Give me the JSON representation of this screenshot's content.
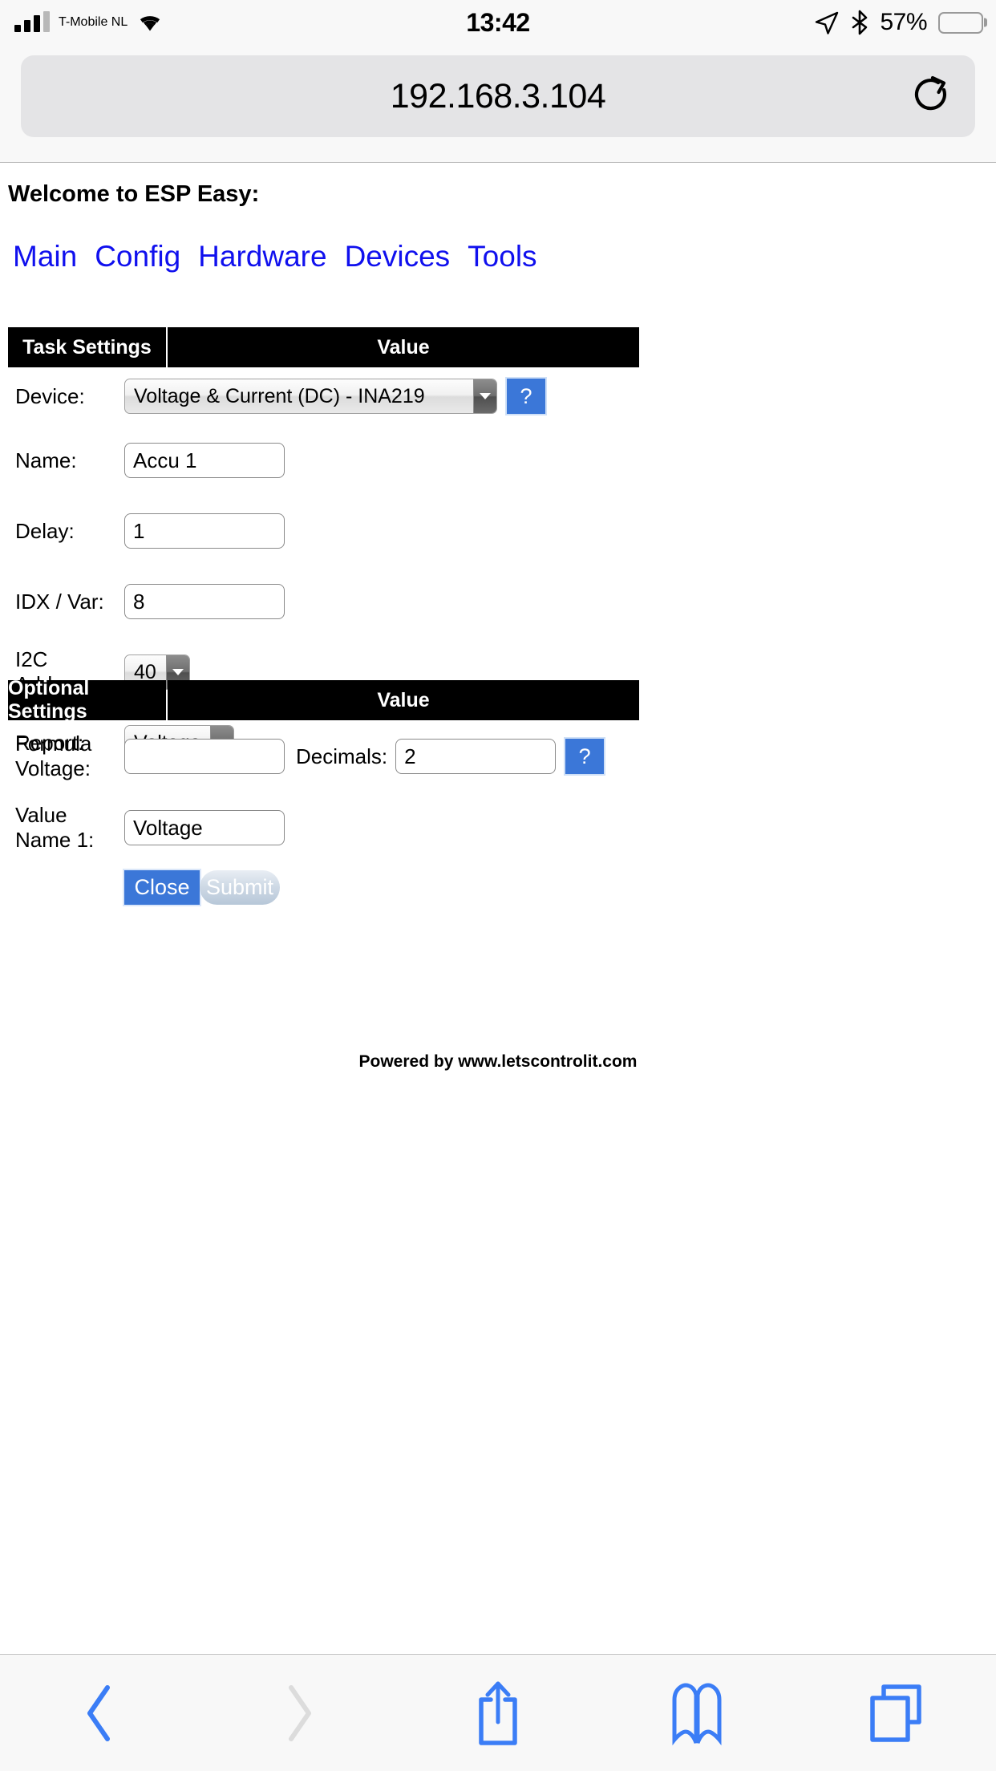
{
  "status_bar": {
    "carrier": "T-Mobile NL",
    "time": "13:42",
    "battery_percent": "57%",
    "signal_icon": "cellular-bars-icon",
    "wifi_icon": "wifi-icon",
    "location_icon": "location-arrow-icon",
    "bluetooth_icon": "bluetooth-icon",
    "battery_icon": "battery-icon",
    "battery_level": 57
  },
  "browser": {
    "url": "192.168.3.104",
    "reload_icon": "reload-icon",
    "toolbar": {
      "back_label": "Back",
      "forward_label": "Forward",
      "share_label": "Share",
      "bookmarks_label": "Bookmarks",
      "tabs_label": "Tabs"
    }
  },
  "page": {
    "heading": "Welcome to ESP Easy:",
    "nav": [
      {
        "label": "Main"
      },
      {
        "label": "Config"
      },
      {
        "label": "Hardware"
      },
      {
        "label": "Devices"
      },
      {
        "label": "Tools"
      }
    ],
    "task_settings": {
      "header_label": "Task Settings",
      "header_value": "Value",
      "rows": {
        "device": {
          "label": "Device:",
          "value": "Voltage & Current (DC) - INA219",
          "help": "?"
        },
        "name": {
          "label": "Name:",
          "value": "Accu 1"
        },
        "delay": {
          "label": "Delay:",
          "value": "1"
        },
        "idx_var": {
          "label": "IDX / Var:",
          "value": "8"
        },
        "i2c_address": {
          "label": "I2C Address:",
          "value": "40"
        },
        "report": {
          "label": "Report:",
          "value": "Voltage"
        }
      }
    },
    "optional_settings": {
      "header_label": "Optional Settings",
      "header_value": "Value",
      "rows": {
        "formula_voltage": {
          "label": "Formula Voltage:",
          "value": "",
          "decimals_label": "Decimals:",
          "decimals_value": "2",
          "help": "?"
        },
        "value_name_1": {
          "label": "Value Name 1:",
          "value": "Voltage"
        }
      }
    },
    "buttons": {
      "close": "Close",
      "submit": "Submit"
    },
    "footer": "Powered by www.letscontrolit.com"
  },
  "colors": {
    "link_blue": "#1010ee",
    "accent_blue": "#3b77d8",
    "header_black": "#000000",
    "chrome_gray": "#f8f8f8",
    "urlbar_gray": "#e4e4e6",
    "toolbar_icon_blue": "#3b7df6",
    "toolbar_icon_disabled": "#d8d8d8"
  }
}
